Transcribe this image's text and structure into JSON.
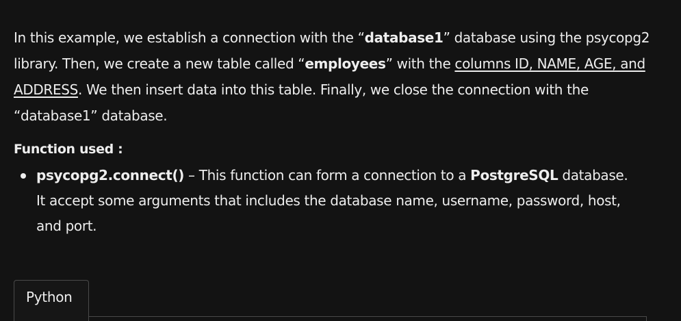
{
  "intro": {
    "t1": "In this example, we establish a connection with the “",
    "db_bold_1": "database1",
    "t2": "” database using the psycopg2 library. Then, we create a new table called “",
    "employees_bold": "employees",
    "t3": "” with the ",
    "columns_link": "columns ID, NAME, AGE, and ADDRESS",
    "t4": ". We then insert data into this table. Finally, we close the connection with the “database1” database."
  },
  "functions_section": {
    "title": "Function used :",
    "items": [
      {
        "name": "psycopg2.connect()",
        "t1": " – This function can form a connection to a ",
        "bold": "PostgreSQL",
        "t2": " database. It accept some arguments that includes the database name, username, password, host, and port."
      }
    ]
  },
  "code_tabs": {
    "tabs": [
      "Python"
    ]
  }
}
